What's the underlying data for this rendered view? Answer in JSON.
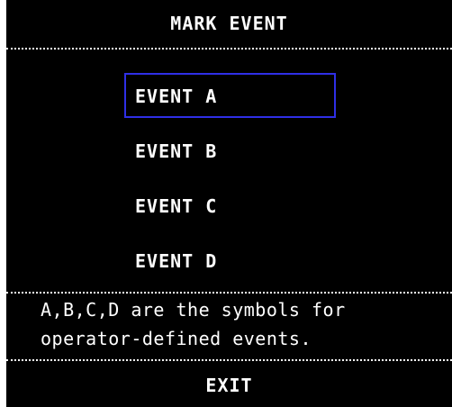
{
  "dialog": {
    "title": "MARK EVENT",
    "menu": {
      "items": [
        {
          "label": "EVENT A",
          "selected": true
        },
        {
          "label": "EVENT B",
          "selected": false
        },
        {
          "label": "EVENT C",
          "selected": false
        },
        {
          "label": "EVENT D",
          "selected": false
        }
      ]
    },
    "description": {
      "line1": "A,B,C,D are the symbols for",
      "line2": "operator-defined events."
    },
    "exit_label": "EXIT"
  },
  "colors": {
    "background": "#000000",
    "text": "#ffffff",
    "selection_border": "#2f2fe6"
  }
}
